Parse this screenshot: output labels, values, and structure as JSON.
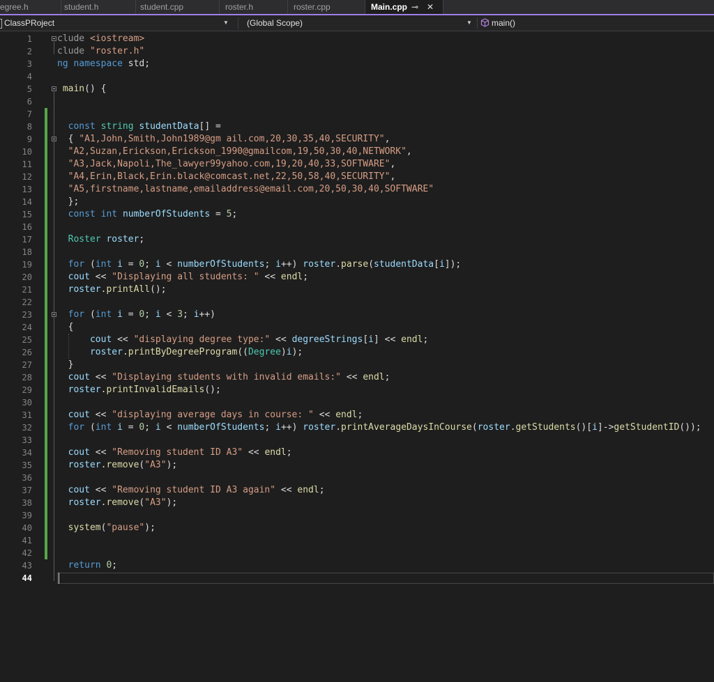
{
  "tabs": [
    {
      "label": "egree.h"
    },
    {
      "label": "student.h"
    },
    {
      "label": "student.cpp"
    },
    {
      "label": "roster.h"
    },
    {
      "label": "roster.cpp"
    },
    {
      "label": "Main.cpp",
      "active": true
    }
  ],
  "tab_pin_glyph": "⊸",
  "tab_close_glyph": "✕",
  "navbar": {
    "project": "ClassPRoject",
    "scope": "(Global Scope)",
    "member": "main()"
  },
  "editor": {
    "current_line": 44,
    "lines": [
      {
        "n": "1",
        "t": [
          [
            "pp",
            "clude "
          ],
          [
            "st",
            "<iostream>"
          ]
        ]
      },
      {
        "n": "2",
        "t": [
          [
            "pp",
            "clude "
          ],
          [
            "st",
            "\"roster.h\""
          ]
        ]
      },
      {
        "n": "3",
        "t": [
          [
            "kw",
            "ng namespace "
          ],
          [
            "",
            "std;"
          ]
        ]
      },
      {
        "n": "4",
        "t": []
      },
      {
        "n": "5",
        "t": [
          [
            "fn",
            " main"
          ],
          [
            "",
            "() {"
          ]
        ]
      },
      {
        "n": "6",
        "t": []
      },
      {
        "n": "7",
        "t": []
      },
      {
        "n": "8",
        "t": [
          [
            "",
            "  "
          ],
          [
            "kw",
            "const "
          ],
          [
            "ty",
            "string "
          ],
          [
            "va",
            "studentData"
          ],
          [
            "",
            "[] ="
          ]
        ]
      },
      {
        "n": "9",
        "t": [
          [
            "",
            "  { "
          ],
          [
            "st",
            "\"A1,John,Smith,John1989@gm ail.com,20,30,35,40,SECURITY\""
          ],
          [
            "",
            ","
          ]
        ]
      },
      {
        "n": "10",
        "t": [
          [
            "",
            "  "
          ],
          [
            "st",
            "\"A2,Suzan,Erickson,Erickson_1990@gmailcom,19,50,30,40,NETWORK\""
          ],
          [
            "",
            ","
          ]
        ]
      },
      {
        "n": "11",
        "t": [
          [
            "",
            "  "
          ],
          [
            "st",
            "\"A3,Jack,Napoli,The_lawyer99yahoo.com,19,20,40,33,SOFTWARE\""
          ],
          [
            "",
            ","
          ]
        ]
      },
      {
        "n": "12",
        "t": [
          [
            "",
            "  "
          ],
          [
            "st",
            "\"A4,Erin,Black,Erin.black@comcast.net,22,50,58,40,SECURITY\""
          ],
          [
            "",
            ","
          ]
        ]
      },
      {
        "n": "13",
        "t": [
          [
            "",
            "  "
          ],
          [
            "st",
            "\"A5,firstname,lastname,emailaddress@email.com,20,50,30,40,SOFTWARE\""
          ]
        ]
      },
      {
        "n": "14",
        "t": [
          [
            "",
            "  };"
          ]
        ]
      },
      {
        "n": "15",
        "t": [
          [
            "",
            "  "
          ],
          [
            "kw",
            "const "
          ],
          [
            "kw",
            "int "
          ],
          [
            "va",
            "numberOfStudents"
          ],
          [
            "",
            " = "
          ],
          [
            "nu",
            "5"
          ],
          [
            "",
            ";"
          ]
        ]
      },
      {
        "n": "16",
        "t": []
      },
      {
        "n": "17",
        "t": [
          [
            "",
            "  "
          ],
          [
            "ty",
            "Roster "
          ],
          [
            "va",
            "roster"
          ],
          [
            "",
            ";"
          ]
        ]
      },
      {
        "n": "18",
        "t": []
      },
      {
        "n": "19",
        "t": [
          [
            "",
            "  "
          ],
          [
            "kw",
            "for "
          ],
          [
            "",
            "("
          ],
          [
            "kw",
            "int "
          ],
          [
            "va",
            "i"
          ],
          [
            "",
            " = "
          ],
          [
            "nu",
            "0"
          ],
          [
            "",
            "; "
          ],
          [
            "va",
            "i"
          ],
          [
            "",
            " < "
          ],
          [
            "va",
            "numberOfStudents"
          ],
          [
            "",
            "; "
          ],
          [
            "va",
            "i"
          ],
          [
            "",
            "++) "
          ],
          [
            "va",
            "roster"
          ],
          [
            "",
            "."
          ],
          [
            "fn",
            "parse"
          ],
          [
            "",
            "("
          ],
          [
            "va",
            "studentData"
          ],
          [
            "",
            "["
          ],
          [
            "va",
            "i"
          ],
          [
            "",
            "]);"
          ]
        ]
      },
      {
        "n": "20",
        "t": [
          [
            "",
            "  "
          ],
          [
            "va",
            "cout"
          ],
          [
            "",
            " << "
          ],
          [
            "st",
            "\"Displaying all students: \""
          ],
          [
            "",
            " << "
          ],
          [
            "fn",
            "endl"
          ],
          [
            "",
            ";"
          ]
        ]
      },
      {
        "n": "21",
        "t": [
          [
            "",
            "  "
          ],
          [
            "va",
            "roster"
          ],
          [
            "",
            "."
          ],
          [
            "fn",
            "printAll"
          ],
          [
            "",
            "();"
          ]
        ]
      },
      {
        "n": "22",
        "t": []
      },
      {
        "n": "23",
        "t": [
          [
            "",
            "  "
          ],
          [
            "kw",
            "for "
          ],
          [
            "",
            "("
          ],
          [
            "kw",
            "int "
          ],
          [
            "va",
            "i"
          ],
          [
            "",
            " = "
          ],
          [
            "nu",
            "0"
          ],
          [
            "",
            "; "
          ],
          [
            "va",
            "i"
          ],
          [
            "",
            " < "
          ],
          [
            "nu",
            "3"
          ],
          [
            "",
            "; "
          ],
          [
            "va",
            "i"
          ],
          [
            "",
            "++)"
          ]
        ]
      },
      {
        "n": "24",
        "t": [
          [
            "",
            "  {"
          ]
        ]
      },
      {
        "n": "25",
        "t": [
          [
            "",
            "      "
          ],
          [
            "va",
            "cout"
          ],
          [
            "",
            " << "
          ],
          [
            "st",
            "\"displaying degree type:\""
          ],
          [
            "",
            " << "
          ],
          [
            "va",
            "degreeStrings"
          ],
          [
            "",
            "["
          ],
          [
            "va",
            "i"
          ],
          [
            "",
            "] << "
          ],
          [
            "fn",
            "endl"
          ],
          [
            "",
            ";"
          ]
        ]
      },
      {
        "n": "26",
        "t": [
          [
            "",
            "      "
          ],
          [
            "va",
            "roster"
          ],
          [
            "",
            "."
          ],
          [
            "fn",
            "printByDegreeProgram"
          ],
          [
            "",
            "(("
          ],
          [
            "ty",
            "Degree"
          ],
          [
            "",
            ")"
          ],
          [
            "va",
            "i"
          ],
          [
            "",
            ");"
          ]
        ]
      },
      {
        "n": "27",
        "t": [
          [
            "",
            "  }"
          ]
        ]
      },
      {
        "n": "28",
        "t": [
          [
            "",
            "  "
          ],
          [
            "va",
            "cout"
          ],
          [
            "",
            " << "
          ],
          [
            "st",
            "\"Displaying students with invalid emails:\""
          ],
          [
            "",
            " << "
          ],
          [
            "fn",
            "endl"
          ],
          [
            "",
            ";"
          ]
        ]
      },
      {
        "n": "29",
        "t": [
          [
            "",
            "  "
          ],
          [
            "va",
            "roster"
          ],
          [
            "",
            "."
          ],
          [
            "fn",
            "printInvalidEmails"
          ],
          [
            "",
            "();"
          ]
        ]
      },
      {
        "n": "30",
        "t": []
      },
      {
        "n": "31",
        "t": [
          [
            "",
            "  "
          ],
          [
            "va",
            "cout"
          ],
          [
            "",
            " << "
          ],
          [
            "st",
            "\"displaying average days in course: \""
          ],
          [
            "",
            " << "
          ],
          [
            "fn",
            "endl"
          ],
          [
            "",
            ";"
          ]
        ]
      },
      {
        "n": "32",
        "t": [
          [
            "",
            "  "
          ],
          [
            "kw",
            "for "
          ],
          [
            "",
            "("
          ],
          [
            "kw",
            "int "
          ],
          [
            "va",
            "i"
          ],
          [
            "",
            " = "
          ],
          [
            "nu",
            "0"
          ],
          [
            "",
            "; "
          ],
          [
            "va",
            "i"
          ],
          [
            "",
            " < "
          ],
          [
            "va",
            "numberOfStudents"
          ],
          [
            "",
            "; "
          ],
          [
            "va",
            "i"
          ],
          [
            "",
            "++) "
          ],
          [
            "va",
            "roster"
          ],
          [
            "",
            "."
          ],
          [
            "fn",
            "printAverageDaysInCourse"
          ],
          [
            "",
            "("
          ],
          [
            "va",
            "roster"
          ],
          [
            "",
            "."
          ],
          [
            "fn",
            "getStudents"
          ],
          [
            "",
            "()["
          ],
          [
            "va",
            "i"
          ],
          [
            "",
            "]->"
          ],
          [
            "fn",
            "getStudentID"
          ],
          [
            "",
            "());"
          ]
        ]
      },
      {
        "n": "33",
        "t": []
      },
      {
        "n": "34",
        "t": [
          [
            "",
            "  "
          ],
          [
            "va",
            "cout"
          ],
          [
            "",
            " << "
          ],
          [
            "st",
            "\"Removing student ID A3\""
          ],
          [
            "",
            " << "
          ],
          [
            "fn",
            "endl"
          ],
          [
            "",
            ";"
          ]
        ]
      },
      {
        "n": "35",
        "t": [
          [
            "",
            "  "
          ],
          [
            "va",
            "roster"
          ],
          [
            "",
            "."
          ],
          [
            "fn",
            "remove"
          ],
          [
            "",
            "("
          ],
          [
            "st",
            "\"A3\""
          ],
          [
            "",
            ");"
          ]
        ]
      },
      {
        "n": "36",
        "t": []
      },
      {
        "n": "37",
        "t": [
          [
            "",
            "  "
          ],
          [
            "va",
            "cout"
          ],
          [
            "",
            " << "
          ],
          [
            "st",
            "\"Removing student ID A3 again\""
          ],
          [
            "",
            " << "
          ],
          [
            "fn",
            "endl"
          ],
          [
            "",
            ";"
          ]
        ]
      },
      {
        "n": "38",
        "t": [
          [
            "",
            "  "
          ],
          [
            "va",
            "roster"
          ],
          [
            "",
            "."
          ],
          [
            "fn",
            "remove"
          ],
          [
            "",
            "("
          ],
          [
            "st",
            "\"A3\""
          ],
          [
            "",
            ");"
          ]
        ]
      },
      {
        "n": "39",
        "t": []
      },
      {
        "n": "40",
        "t": [
          [
            "",
            "  "
          ],
          [
            "fn",
            "system"
          ],
          [
            "",
            "("
          ],
          [
            "st",
            "\"pause\""
          ],
          [
            "",
            ");"
          ]
        ]
      },
      {
        "n": "41",
        "t": []
      },
      {
        "n": "42",
        "t": []
      },
      {
        "n": "43",
        "t": [
          [
            "",
            "  "
          ],
          [
            "kw",
            "return "
          ],
          [
            "nu",
            "0"
          ],
          [
            "",
            ";"
          ]
        ]
      },
      {
        "n": "44",
        "t": []
      }
    ]
  }
}
